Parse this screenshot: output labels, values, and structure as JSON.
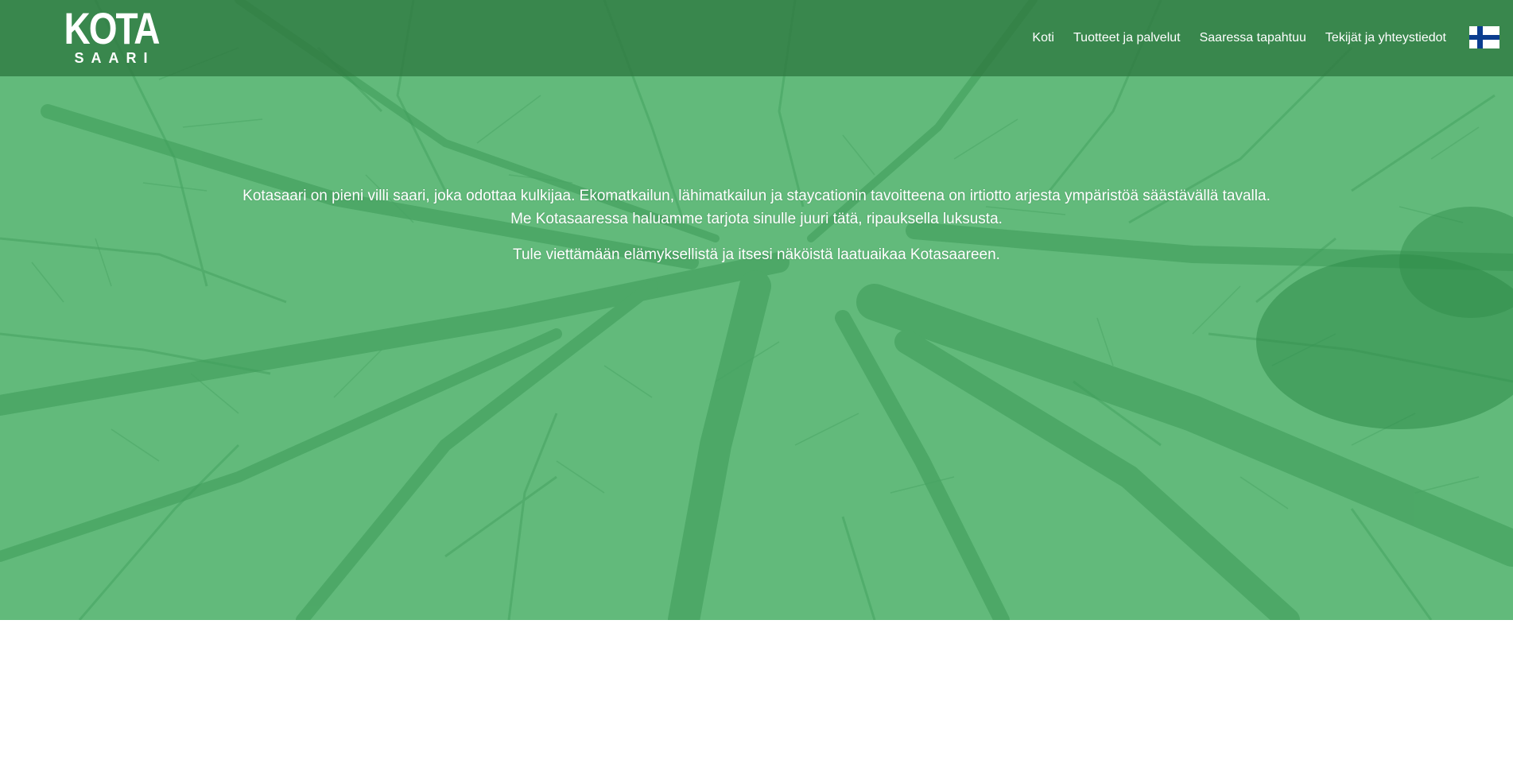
{
  "logo": {
    "word": "KOTA",
    "sub": "SAARI"
  },
  "nav": {
    "items": [
      {
        "label": "Koti"
      },
      {
        "label": "Tuotteet ja palvelut"
      },
      {
        "label": "Saaressa tapahtuu"
      },
      {
        "label": "Tekijät ja yhteystiedot"
      }
    ],
    "language_flag": "finland-flag-icon"
  },
  "hero": {
    "paragraph_1": "Kotasaari on pieni villi saari, joka odottaa kulkijaa. Ekomatkailun, lähimatkailun ja staycationin tavoitteena on irtiotto arjesta ympäristöä säästävällä tavalla. Me Kotasaaressa haluamme tarjota sinulle juuri tätä, ripauksella luksusta.",
    "paragraph_2": "Tule viettämään elämyksellistä ja itsesi näköistä laatuaikaa Kotasaareen."
  },
  "colors": {
    "hero_green": "#62ba7b",
    "topbar_green": "#2e7840",
    "text": "#ffffff",
    "flag_blue": "#0b3d8f"
  }
}
